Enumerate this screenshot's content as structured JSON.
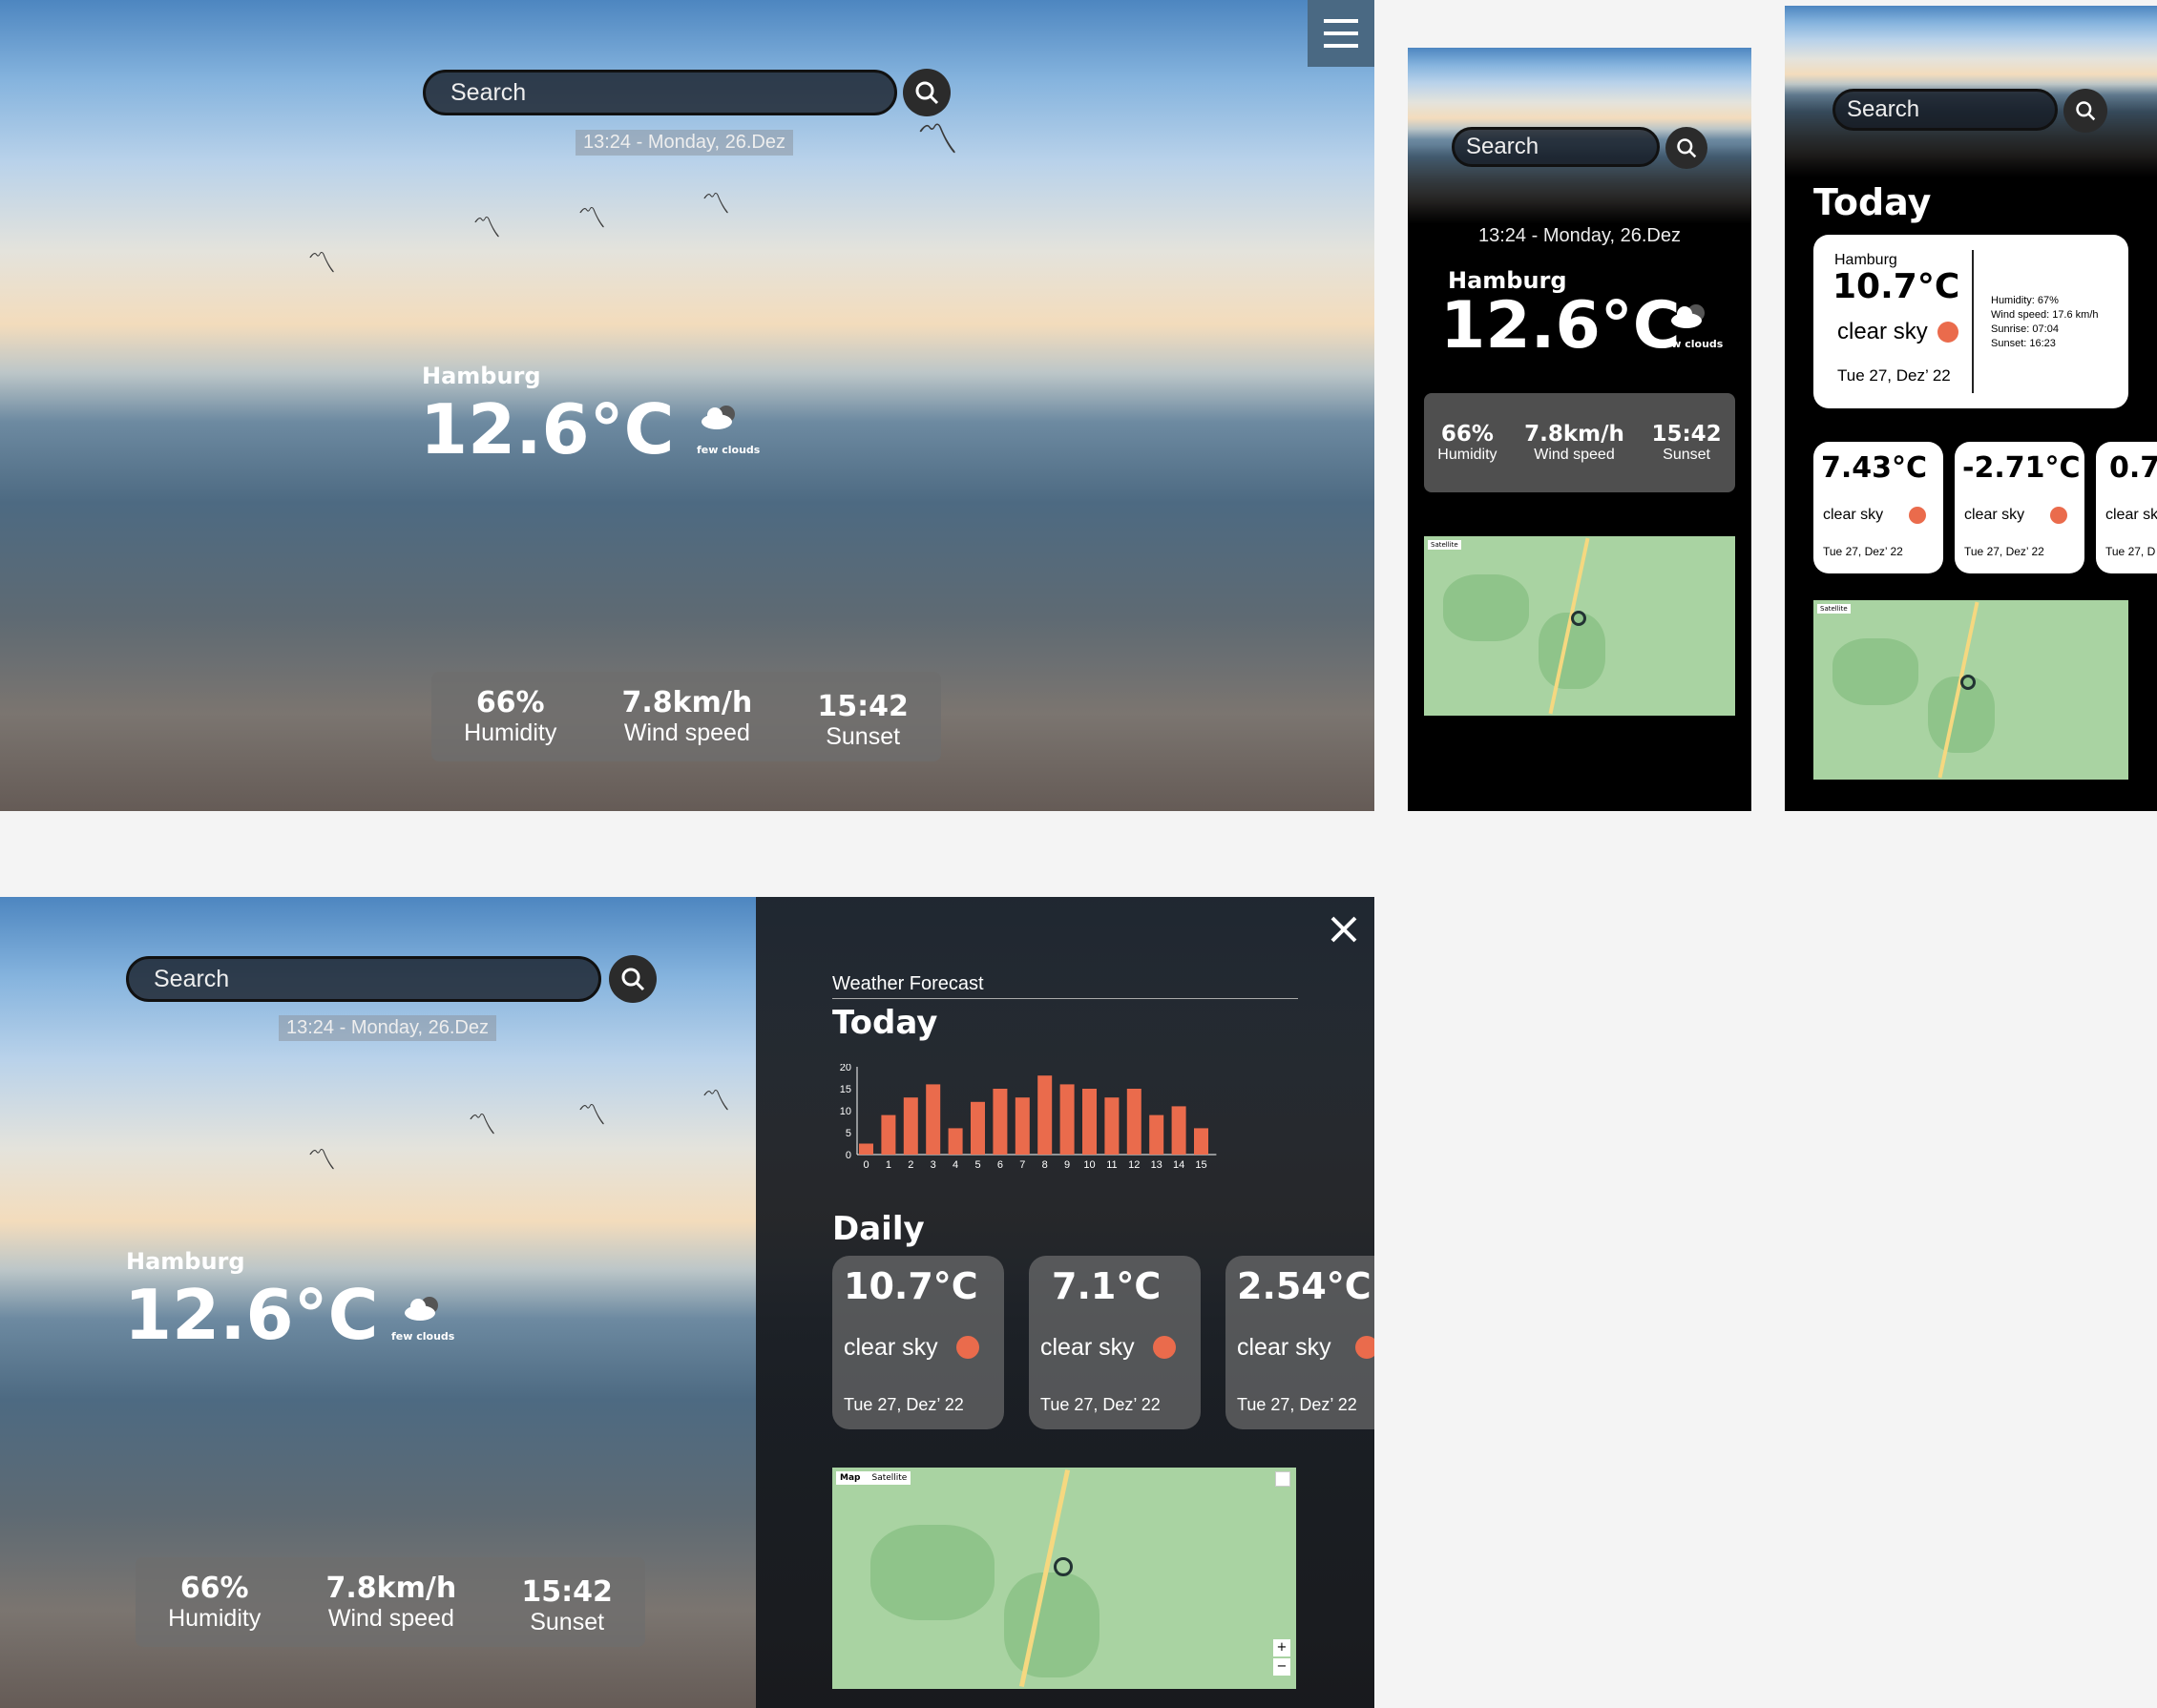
{
  "search": {
    "placeholder": "Search"
  },
  "datetime": "13:24 - Monday, 26.Dez",
  "city": "Hamburg",
  "temperature": "12.6°C",
  "condition": "few clouds",
  "stats": {
    "humidity_value": "66%",
    "humidity_label": "Humidity",
    "wind_value": "7.8km/h",
    "wind_label": "Wind speed",
    "sunset_value": "15:42",
    "sunset_label": "Sunset"
  },
  "icons": [
    "menu-icon",
    "search-icon",
    "cloud-icon",
    "close-icon",
    "location-pin-icon"
  ],
  "colors": {
    "accent": "#ea6b4c",
    "panel_dark": "#1e2024"
  },
  "map": {
    "satellite_label": "Satellite",
    "map_label": "Map",
    "zoom_in": "+",
    "zoom_out": "−"
  },
  "today_card": {
    "heading": "Today",
    "city": "Hamburg",
    "temp": "10.7°C",
    "condition": "clear sky",
    "date": "Tue 27, Dez’ 22",
    "humidity": "Humidity: 67%",
    "wind": "Wind speed: 17.6 km/h",
    "sunrise": "Sunrise: 07:04",
    "sunset": "Sunset: 16:23"
  },
  "mobile_cards": [
    {
      "temp": "7.43°C",
      "condition": "clear sky",
      "date": "Tue 27, Dez’ 22"
    },
    {
      "temp": "-2.71°C",
      "condition": "clear sky",
      "date": "Tue 27, Dez’ 22"
    },
    {
      "temp": "0.7",
      "condition": "clear sk",
      "date": "Tue 27, D"
    }
  ],
  "forecast": {
    "title": "Weather Forecast",
    "today": "Today",
    "daily": "Daily",
    "cards": [
      {
        "temp": "10.7°C",
        "condition": "clear sky",
        "date": "Tue 27, Dez’ 22"
      },
      {
        "temp": "7.1°C",
        "condition": "clear sky",
        "date": "Tue 27, Dez’ 22"
      },
      {
        "temp": "2.54°C",
        "condition": "clear sky",
        "date": "Tue 27, Dez’ 22"
      }
    ]
  },
  "chart_data": {
    "type": "bar",
    "categories": [
      "0",
      "1",
      "2",
      "3",
      "4",
      "5",
      "6",
      "7",
      "8",
      "9",
      "10",
      "11",
      "12",
      "13",
      "14",
      "15"
    ],
    "values": [
      2.5,
      9,
      13,
      16,
      6,
      12,
      15,
      13,
      18,
      16,
      15,
      13,
      15,
      9,
      11,
      6
    ],
    "ylim": [
      0,
      20
    ],
    "yticks": [
      "0",
      "5",
      "10",
      "15",
      "20"
    ],
    "bar_color": "#ea6b4c"
  }
}
